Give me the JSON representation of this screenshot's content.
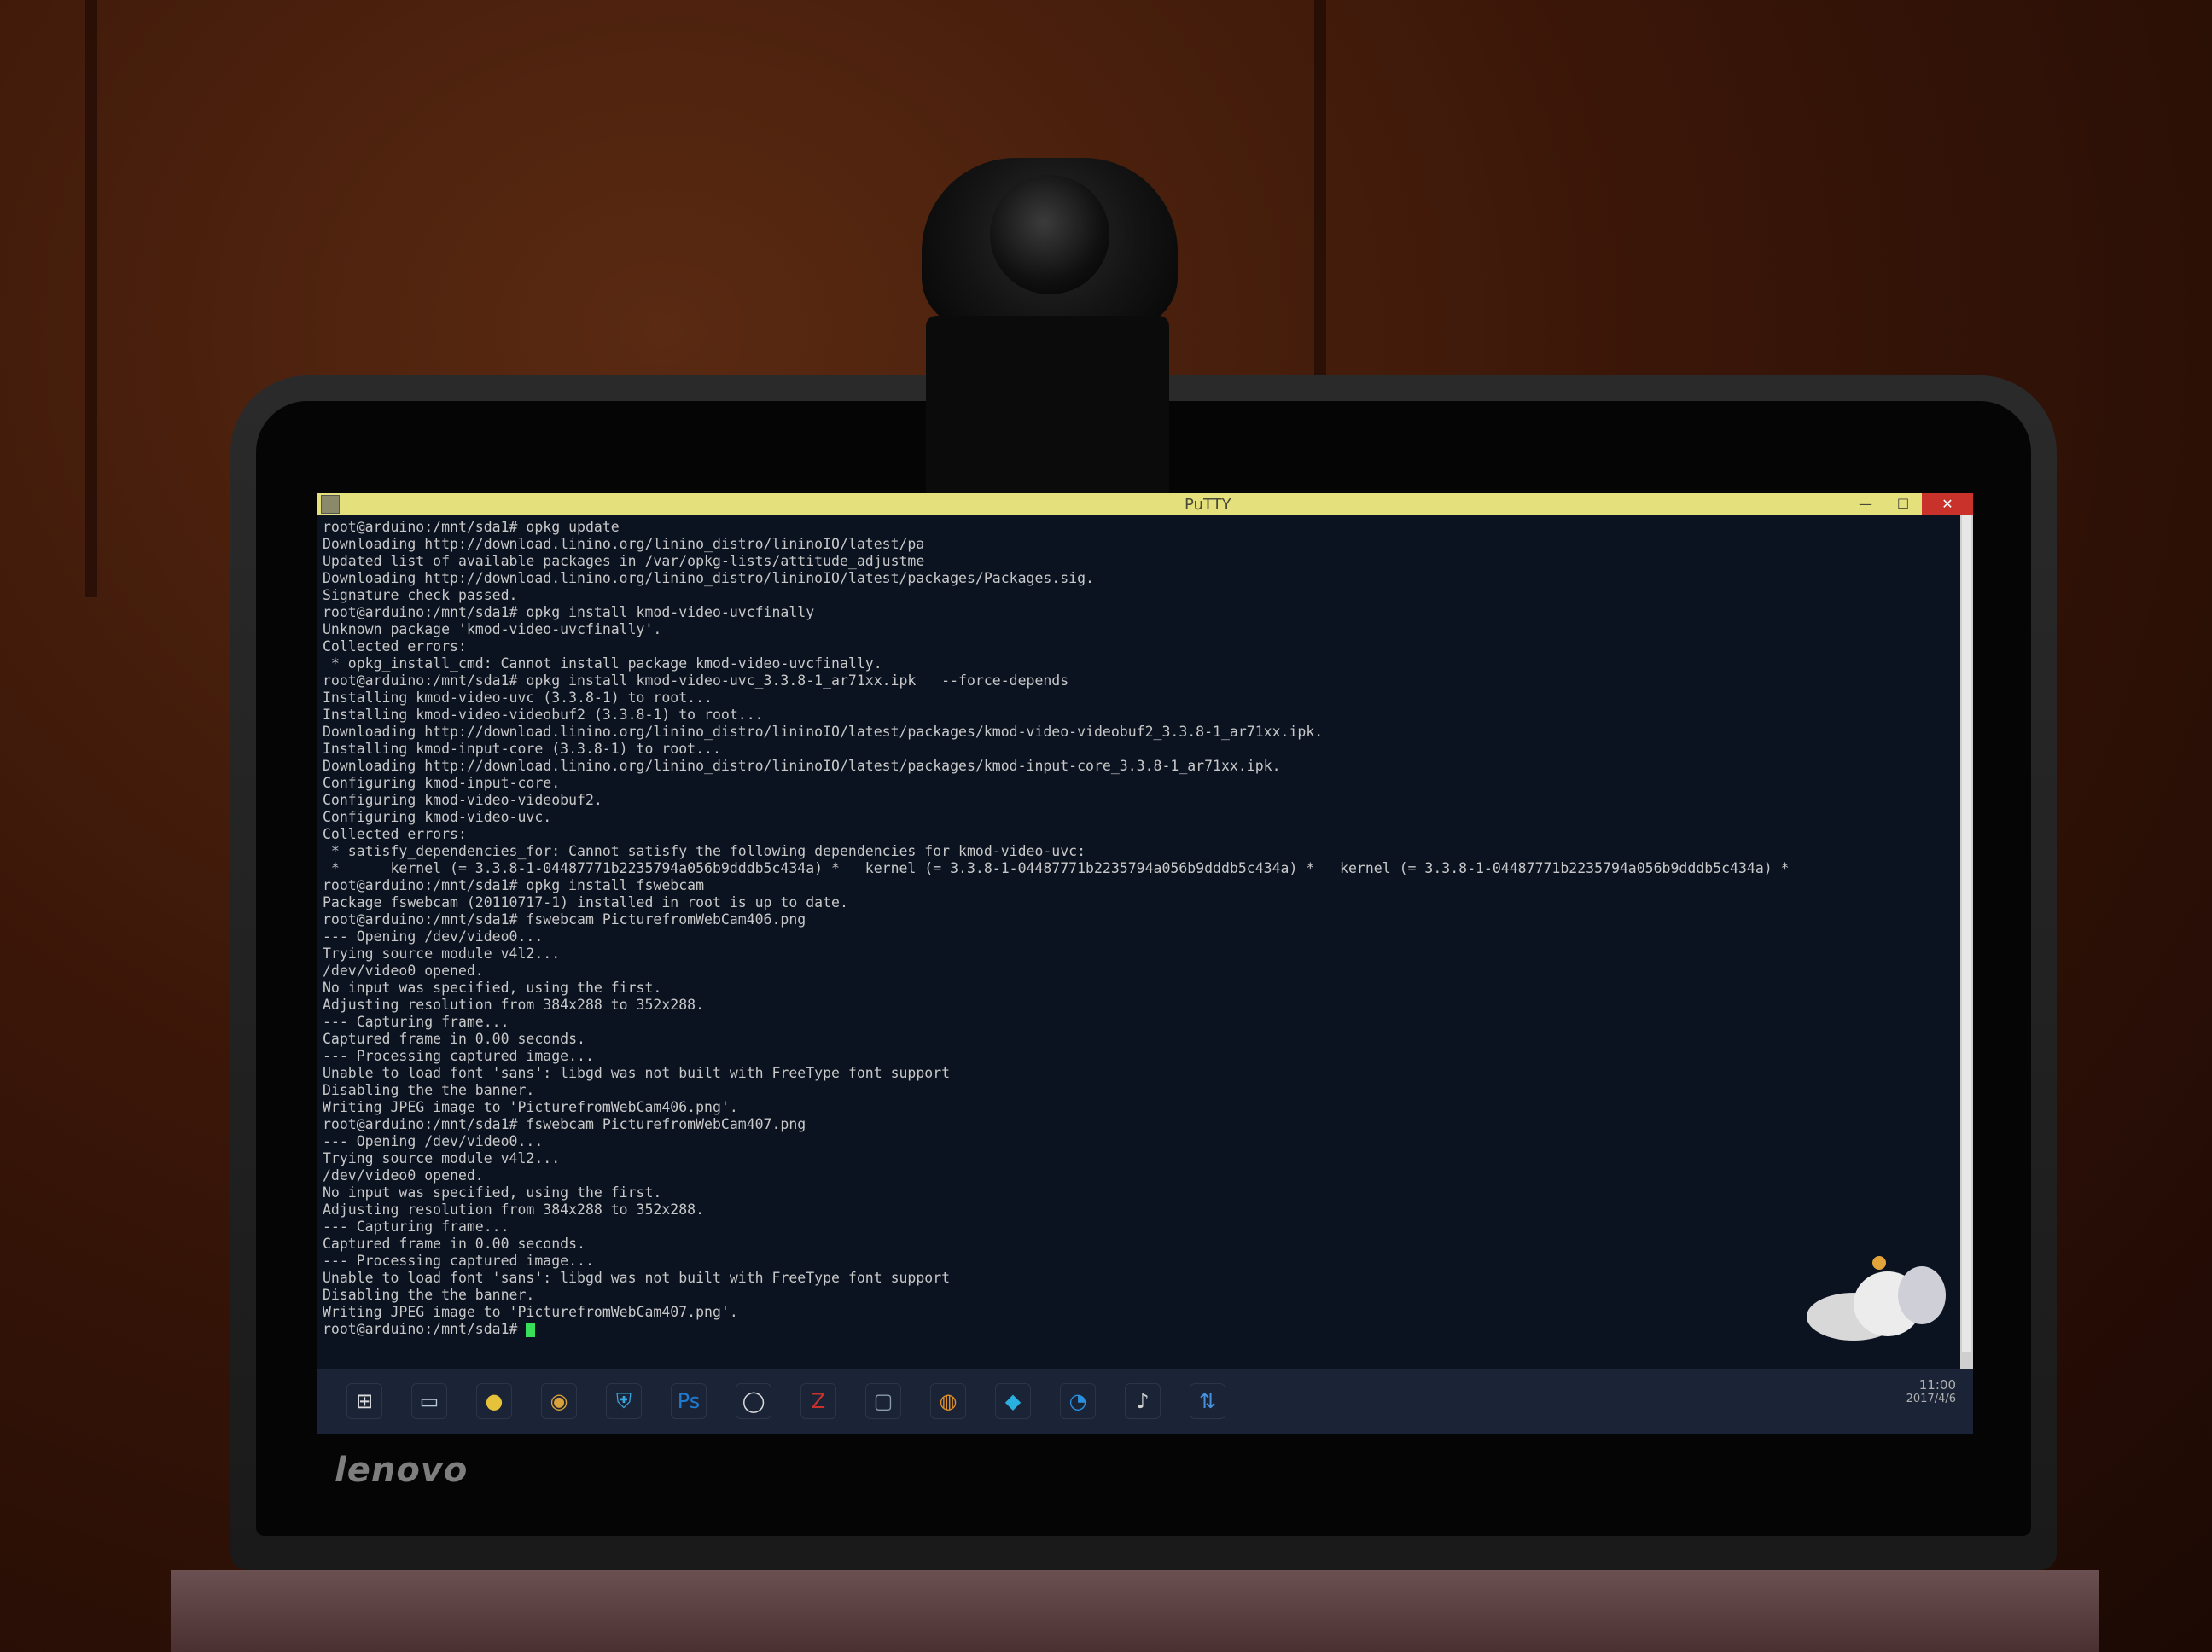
{
  "window": {
    "title": "PuTTY",
    "close_glyph": "✕",
    "minimize_glyph": "—",
    "maximize_glyph": "☐"
  },
  "terminal": {
    "lines": [
      "root@arduino:/mnt/sda1# opkg update",
      "Downloading http://download.linino.org/linino_distro/lininoIO/latest/pa",
      "Updated list of available packages in /var/opkg-lists/attitude_adjustme",
      "Downloading http://download.linino.org/linino_distro/lininoIO/latest/packages/Packages.sig.",
      "Signature check passed.",
      "root@arduino:/mnt/sda1# opkg install kmod-video-uvcfinally",
      "Unknown package 'kmod-video-uvcfinally'.",
      "Collected errors:",
      " * opkg_install_cmd: Cannot install package kmod-video-uvcfinally.",
      "root@arduino:/mnt/sda1# opkg install kmod-video-uvc_3.3.8-1_ar71xx.ipk   --force-depends",
      "Installing kmod-video-uvc (3.3.8-1) to root...",
      "Installing kmod-video-videobuf2 (3.3.8-1) to root...",
      "Downloading http://download.linino.org/linino_distro/lininoIO/latest/packages/kmod-video-videobuf2_3.3.8-1_ar71xx.ipk.",
      "Installing kmod-input-core (3.3.8-1) to root...",
      "Downloading http://download.linino.org/linino_distro/lininoIO/latest/packages/kmod-input-core_3.3.8-1_ar71xx.ipk.",
      "Configuring kmod-input-core.",
      "Configuring kmod-video-videobuf2.",
      "Configuring kmod-video-uvc.",
      "Collected errors:",
      " * satisfy_dependencies_for: Cannot satisfy the following dependencies for kmod-video-uvc:",
      " *      kernel (= 3.3.8-1-04487771b2235794a056b9dddb5c434a) *   kernel (= 3.3.8-1-04487771b2235794a056b9dddb5c434a) *   kernel (= 3.3.8-1-04487771b2235794a056b9dddb5c434a) *",
      "root@arduino:/mnt/sda1# opkg install fswebcam",
      "Package fswebcam (20110717-1) installed in root is up to date.",
      "root@arduino:/mnt/sda1# fswebcam PicturefromWebCam406.png",
      "--- Opening /dev/video0...",
      "Trying source module v4l2...",
      "/dev/video0 opened.",
      "No input was specified, using the first.",
      "Adjusting resolution from 384x288 to 352x288.",
      "--- Capturing frame...",
      "Captured frame in 0.00 seconds.",
      "--- Processing captured image...",
      "Unable to load font 'sans': libgd was not built with FreeType font support",
      "",
      "Disabling the the banner.",
      "Writing JPEG image to 'PicturefromWebCam406.png'.",
      "root@arduino:/mnt/sda1# fswebcam PicturefromWebCam407.png",
      "--- Opening /dev/video0...",
      "Trying source module v4l2...",
      "/dev/video0 opened.",
      "No input was specified, using the first.",
      "Adjusting resolution from 384x288 to 352x288.",
      "--- Capturing frame...",
      "Captured frame in 0.00 seconds.",
      "--- Processing captured image...",
      "Unable to load font 'sans': libgd was not built with FreeType font support",
      "",
      "Disabling the the banner.",
      "Writing JPEG image to 'PicturefromWebCam407.png'.",
      "root@arduino:/mnt/sda1# "
    ]
  },
  "taskbar": {
    "icons": [
      {
        "name": "start-icon",
        "glyph": "⊞",
        "color": "#dcdcdc"
      },
      {
        "name": "file-explorer-icon",
        "glyph": "▭",
        "color": "#b9c9dc"
      },
      {
        "name": "chat-app-icon",
        "glyph": "●",
        "color": "#e6c23a"
      },
      {
        "name": "chrome-icon",
        "glyph": "◉",
        "color": "#d9a23a"
      },
      {
        "name": "security-shield-icon",
        "glyph": "⛨",
        "color": "#3aa8e0"
      },
      {
        "name": "photoshop-icon",
        "glyph": "Ps",
        "color": "#1f7ad0"
      },
      {
        "name": "speech-bubble-icon",
        "glyph": "◯",
        "color": "#d9d9d9"
      },
      {
        "name": "filezilla-icon",
        "glyph": "Z",
        "color": "#c8322a"
      },
      {
        "name": "monitor-icon",
        "glyph": "▢",
        "color": "#8a9ab0"
      },
      {
        "name": "globe-icon",
        "glyph": "◍",
        "color": "#e0902a"
      },
      {
        "name": "blue-app-icon",
        "glyph": "◆",
        "color": "#2ab0e0"
      },
      {
        "name": "camera-app-icon",
        "glyph": "◔",
        "color": "#2a90e0"
      },
      {
        "name": "media-app-icon",
        "glyph": "♪",
        "color": "#d0d0d0"
      },
      {
        "name": "network-app-icon",
        "glyph": "⇅",
        "color": "#4a90e0"
      }
    ],
    "tray": {
      "time": "11:00",
      "date": "2017/4/6"
    }
  },
  "laptop": {
    "brand": "lenovo"
  }
}
